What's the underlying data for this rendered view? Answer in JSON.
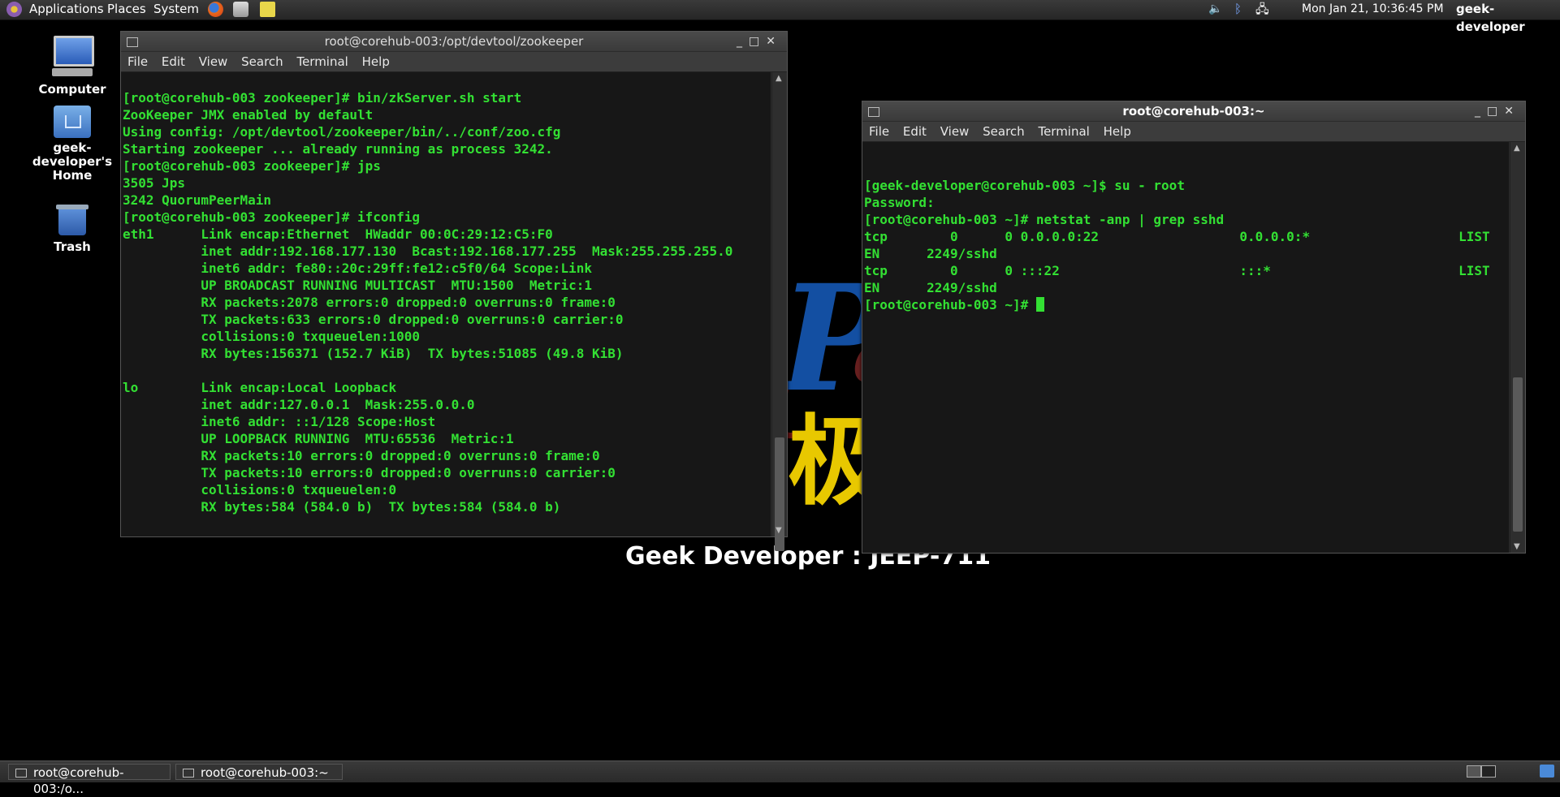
{
  "top_panel": {
    "menus": [
      "Applications",
      "Places",
      "System"
    ],
    "clock": "Mon Jan 21, 10:36:45 PM",
    "user": "geek-developer"
  },
  "desktop": {
    "icons": [
      {
        "label": "Computer",
        "icon": "computer-icon"
      },
      {
        "label": "geek-developer's Home",
        "icon": "home-folder-icon"
      },
      {
        "label": "Trash",
        "icon": "trash-icon"
      }
    ]
  },
  "window_left": {
    "title": "root@corehub-003:/opt/devtool/zookeeper",
    "menu": [
      "File",
      "Edit",
      "View",
      "Search",
      "Terminal",
      "Help"
    ],
    "lines": [
      "",
      "[root@corehub-003 zookeeper]# bin/zkServer.sh start",
      "ZooKeeper JMX enabled by default",
      "Using config: /opt/devtool/zookeeper/bin/../conf/zoo.cfg",
      "Starting zookeeper ... already running as process 3242.",
      "[root@corehub-003 zookeeper]# jps",
      "3505 Jps",
      "3242 QuorumPeerMain",
      "[root@corehub-003 zookeeper]# ifconfig",
      "eth1      Link encap:Ethernet  HWaddr 00:0C:29:12:C5:F0",
      "          inet addr:192.168.177.130  Bcast:192.168.177.255  Mask:255.255.255.0",
      "          inet6 addr: fe80::20c:29ff:fe12:c5f0/64 Scope:Link",
      "          UP BROADCAST RUNNING MULTICAST  MTU:1500  Metric:1",
      "          RX packets:2078 errors:0 dropped:0 overruns:0 frame:0",
      "          TX packets:633 errors:0 dropped:0 overruns:0 carrier:0",
      "          collisions:0 txqueuelen:1000",
      "          RX bytes:156371 (152.7 KiB)  TX bytes:51085 (49.8 KiB)",
      "",
      "lo        Link encap:Local Loopback",
      "          inet addr:127.0.0.1  Mask:255.0.0.0",
      "          inet6 addr: ::1/128 Scope:Host",
      "          UP LOOPBACK RUNNING  MTU:65536  Metric:1",
      "          RX packets:10 errors:0 dropped:0 overruns:0 frame:0",
      "          TX packets:10 errors:0 dropped:0 overruns:0 carrier:0",
      "          collisions:0 txqueuelen:0",
      "          RX bytes:584 (584.0 b)  TX bytes:584 (584.0 b)"
    ]
  },
  "window_right": {
    "title": "root@corehub-003:~",
    "menu": [
      "File",
      "Edit",
      "View",
      "Search",
      "Terminal",
      "Help"
    ],
    "lines": [
      "[geek-developer@corehub-003 ~]$ su - root",
      "Password:",
      "[root@corehub-003 ~]# netstat -anp | grep sshd",
      "tcp        0      0 0.0.0.0:22                  0.0.0.0:*                   LIST",
      "EN      2249/sshd",
      "tcp        0      0 :::22                       :::*                        LIST",
      "EN      2249/sshd"
    ],
    "prompt": "[root@corehub-003 ~]# "
  },
  "watermark": {
    "caption": "Geek Developer : JEEP-711"
  },
  "taskbar": {
    "tasks": [
      "root@corehub-003:/o...",
      "root@corehub-003:~"
    ]
  },
  "colors": {
    "terminal_text": "#33e033",
    "terminal_bg": "#171717"
  }
}
